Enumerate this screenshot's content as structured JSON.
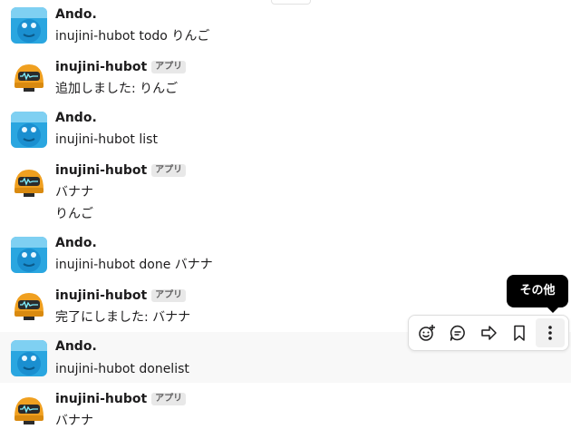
{
  "users": {
    "ando": "Ando.",
    "bot": "inujini-hubot",
    "app_badge": "アプリ"
  },
  "messages": [
    {
      "lines": [
        "inujini-hubot todo りんご"
      ]
    },
    {
      "lines": [
        "追加しました: りんご"
      ]
    },
    {
      "lines": [
        "inujini-hubot list"
      ]
    },
    {
      "lines": [
        "バナナ",
        "りんご"
      ]
    },
    {
      "lines": [
        "inujini-hubot done バナナ"
      ]
    },
    {
      "lines": [
        "完了にしました: バナナ"
      ]
    },
    {
      "lines": [
        "inujini-hubot donelist"
      ]
    },
    {
      "lines": [
        "バナナ"
      ]
    }
  ],
  "toolbar": {
    "tooltip": "その他",
    "icons": [
      "add-reaction-icon",
      "reply-thread-icon",
      "share-icon",
      "bookmark-icon",
      "more-actions-icon"
    ]
  },
  "colors": {
    "ando_avatar": "#2aa6e0",
    "bot_avatar": "#f0a020",
    "hover_row": "#f8f8f8",
    "badge_bg": "#e8e8e8"
  }
}
